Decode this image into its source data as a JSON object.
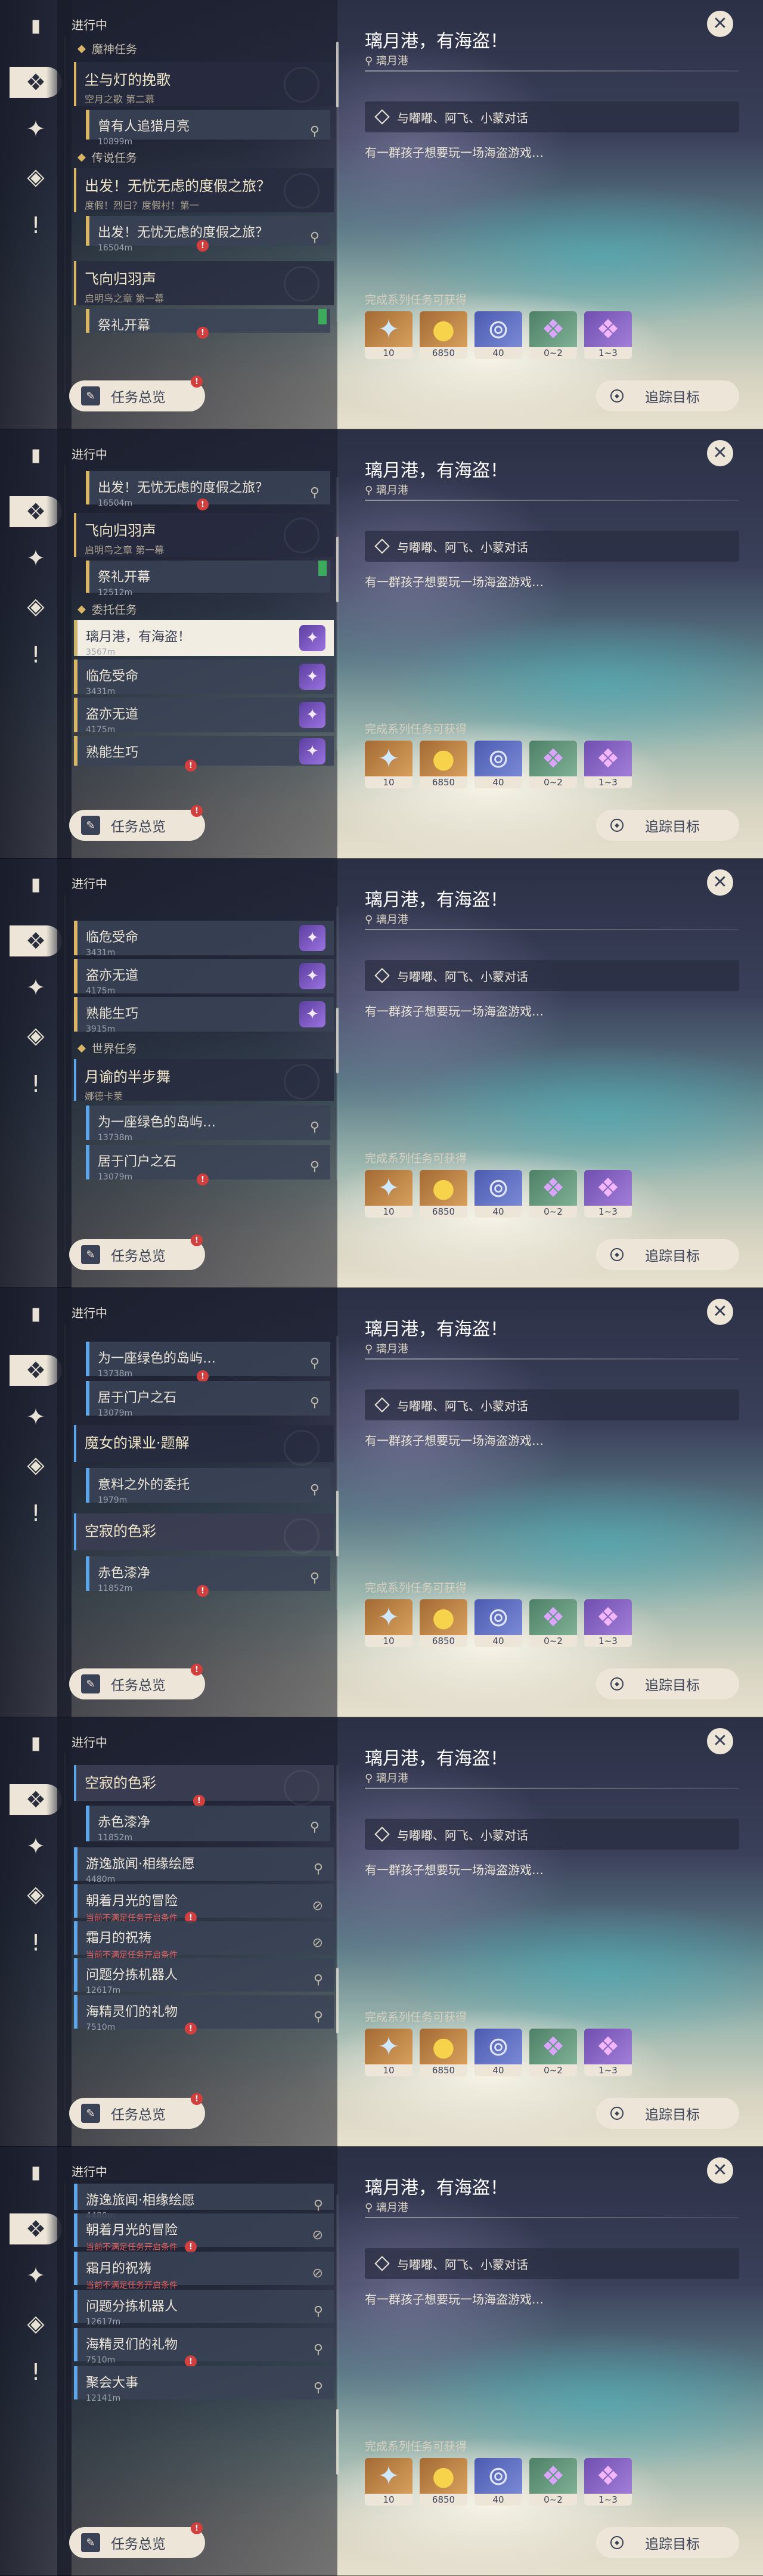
{
  "header": {
    "in_progress": "进行中"
  },
  "quest_detail": {
    "title": "璃月港，有海盗！",
    "location": "璃月港",
    "objective": "与嘟嘟、阿飞、小蒙对话",
    "description": "有一群孩子想要玩一场海盗游戏…",
    "rewards_label": "完成系列任务可获得",
    "rewards": [
      {
        "icon": "adventure-exp-icon",
        "count": "10"
      },
      {
        "icon": "mora-icon",
        "count": "6850"
      },
      {
        "icon": "companionship-exp-icon",
        "count": "40"
      },
      {
        "icon": "crystal-icon",
        "count": "0~2"
      },
      {
        "icon": "crystal-chunk-icon",
        "count": "1~3"
      }
    ]
  },
  "buttons": {
    "overview": "任务总览",
    "track": "追踪目标"
  },
  "frames": [
    {
      "categories": [
        {
          "label": "魔神任务",
          "icon": "archon-icon"
        },
        {
          "label": "传说任务",
          "icon": "legend-icon"
        }
      ],
      "quests": [
        {
          "title": "尘与灯的挽歌",
          "sub": "空月之歌 第二幕"
        },
        {
          "sub_title": "曾有人追猎月亮",
          "dist": "10899m"
        },
        {
          "title": "出发！无忧无虑的度假之旅？",
          "sub": "度假！烈日？度假村！第一"
        },
        {
          "sub_title": "出发！无忧无虑的度假之旅？",
          "dist": "16504m"
        },
        {
          "title": "飞向归羽声",
          "sub": "启明鸟之章 第一幕"
        },
        {
          "sub_title": "祭礼开幕"
        }
      ]
    },
    {
      "categories": [
        {
          "label": "委托任务",
          "icon": "commission-icon"
        }
      ],
      "quests": [
        {
          "sub_title": "出发！无忧无虑的度假之旅？",
          "dist": "16504m"
        },
        {
          "title": "飞向归羽声",
          "sub": "启明鸟之章 第一幕"
        },
        {
          "sub_title": "祭礼开幕",
          "dist": "12512m"
        },
        {
          "sub_title": "璃月港，有海盗！",
          "dist": "3567m"
        },
        {
          "sub_title": "临危受命",
          "dist": "3431m"
        },
        {
          "sub_title": "盗亦无道",
          "dist": "4175m"
        },
        {
          "sub_title": "熟能生巧"
        }
      ]
    },
    {
      "categories": [
        {
          "label": "世界任务",
          "icon": "world-icon"
        }
      ],
      "quests": [
        {
          "sub_title": "临危受命",
          "dist": "3431m"
        },
        {
          "sub_title": "盗亦无道",
          "dist": "4175m"
        },
        {
          "sub_title": "熟能生巧",
          "dist": "3915m"
        },
        {
          "title": "月谕的半步舞",
          "sub": "娜德卡莱"
        },
        {
          "sub_title": "为一座绿色的岛屿…",
          "dist": "13738m"
        },
        {
          "sub_title": "居于门户之石",
          "dist": "13079m"
        }
      ]
    },
    {
      "categories": [],
      "quests": [
        {
          "sub_title": "为一座绿色的岛屿…",
          "dist": "13738m"
        },
        {
          "sub_title": "居于门户之石",
          "dist": "13079m"
        },
        {
          "title": "魔女的课业·题解"
        },
        {
          "sub_title": "意料之外的委托",
          "dist": "1979m"
        },
        {
          "title": "空寂的色彩"
        },
        {
          "sub_title": "赤色漆净",
          "dist": "11852m"
        }
      ]
    },
    {
      "categories": [],
      "quests": [
        {
          "title": "空寂的色彩"
        },
        {
          "sub_title": "赤色漆净",
          "dist": "11852m"
        },
        {
          "sub_title": "游逸旅闻·相缘绘愿",
          "dist": "4480m"
        },
        {
          "sub_title": "朝着月光的冒险",
          "dist": "当前不满足任务开启条件"
        },
        {
          "sub_title": "霜月的祝祷",
          "dist": "当前不满足任务开启条件"
        },
        {
          "sub_title": "问题分拣机器人",
          "dist": "12617m"
        },
        {
          "sub_title": "海精灵们的礼物",
          "dist": "7510m"
        }
      ]
    },
    {
      "categories": [],
      "quests": [
        {
          "sub_title": "游逸旅闻·相缘绘愿",
          "dist": "4480m"
        },
        {
          "sub_title": "朝着月光的冒险",
          "dist": "当前不满足任务开启条件"
        },
        {
          "sub_title": "霜月的祝祷",
          "dist": "当前不满足任务开启条件"
        },
        {
          "sub_title": "问题分拣机器人",
          "dist": "12617m"
        },
        {
          "sub_title": "海精灵们的礼物",
          "dist": "7510m"
        },
        {
          "sub_title": "聚会大事",
          "dist": "12141m"
        }
      ]
    }
  ]
}
